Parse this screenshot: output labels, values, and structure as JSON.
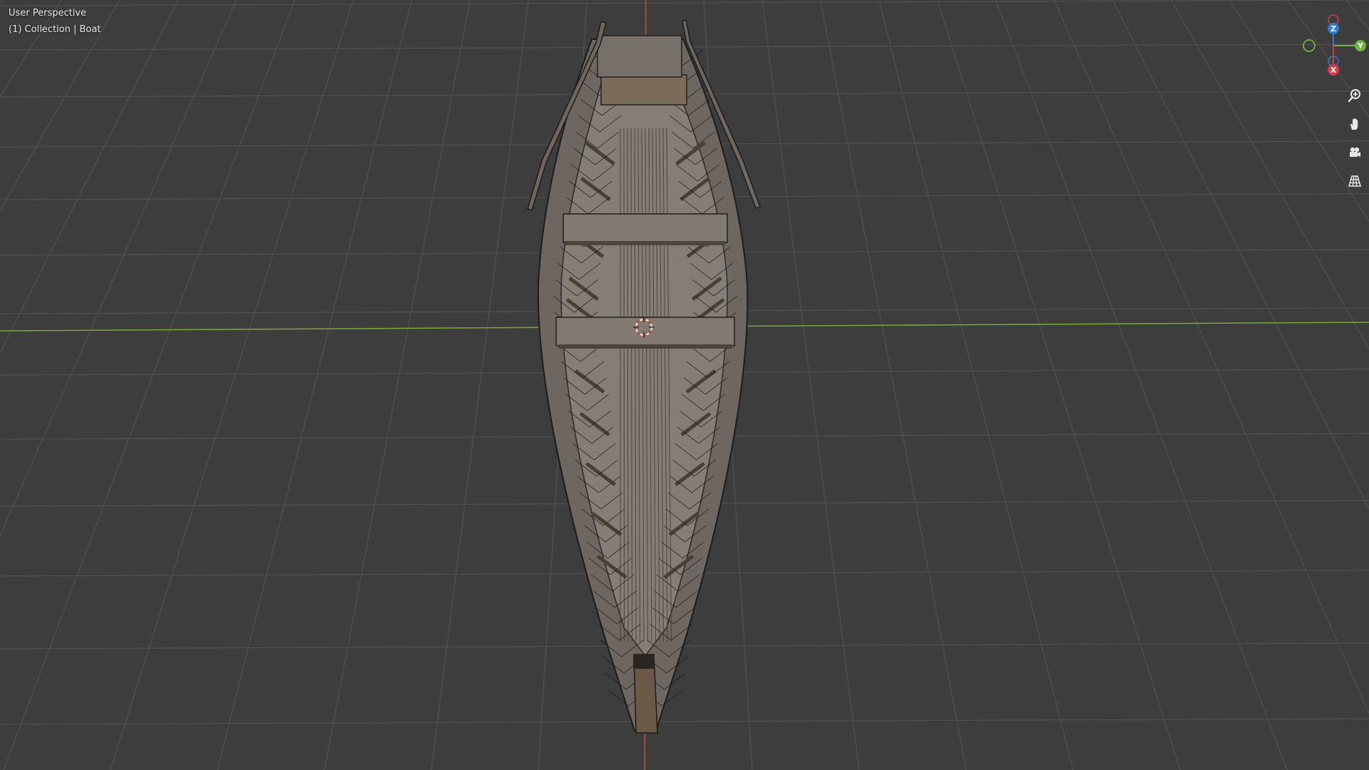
{
  "viewport": {
    "view_mode": "User Perspective",
    "collection_info": "(1) Collection | Boat"
  },
  "gizmo": {
    "axes": [
      {
        "label": "Z",
        "color": "#2f7bd8"
      },
      {
        "label": "Y",
        "color": "#6db33f"
      },
      {
        "label": "X",
        "color": "#d83a4a"
      }
    ],
    "negative_axes": [
      "-Z",
      "-Y",
      "-X"
    ]
  },
  "navigation": {
    "buttons": [
      {
        "name": "zoom",
        "icon": "zoom-in-icon"
      },
      {
        "name": "pan",
        "icon": "hand-icon"
      },
      {
        "name": "camera",
        "icon": "camera-icon"
      },
      {
        "name": "orthographic",
        "icon": "grid-icon"
      }
    ]
  },
  "colors": {
    "background": "#3d3d3d",
    "grid_line": "#555555",
    "x_axis": "#b5463f",
    "y_axis": "#7aa83a",
    "boat_hull": "#6f6862",
    "boat_interior": "#8a827b",
    "boat_wood": "#7a6a58"
  },
  "scene_object": {
    "name": "Boat",
    "shading": "wireframe overlay"
  }
}
